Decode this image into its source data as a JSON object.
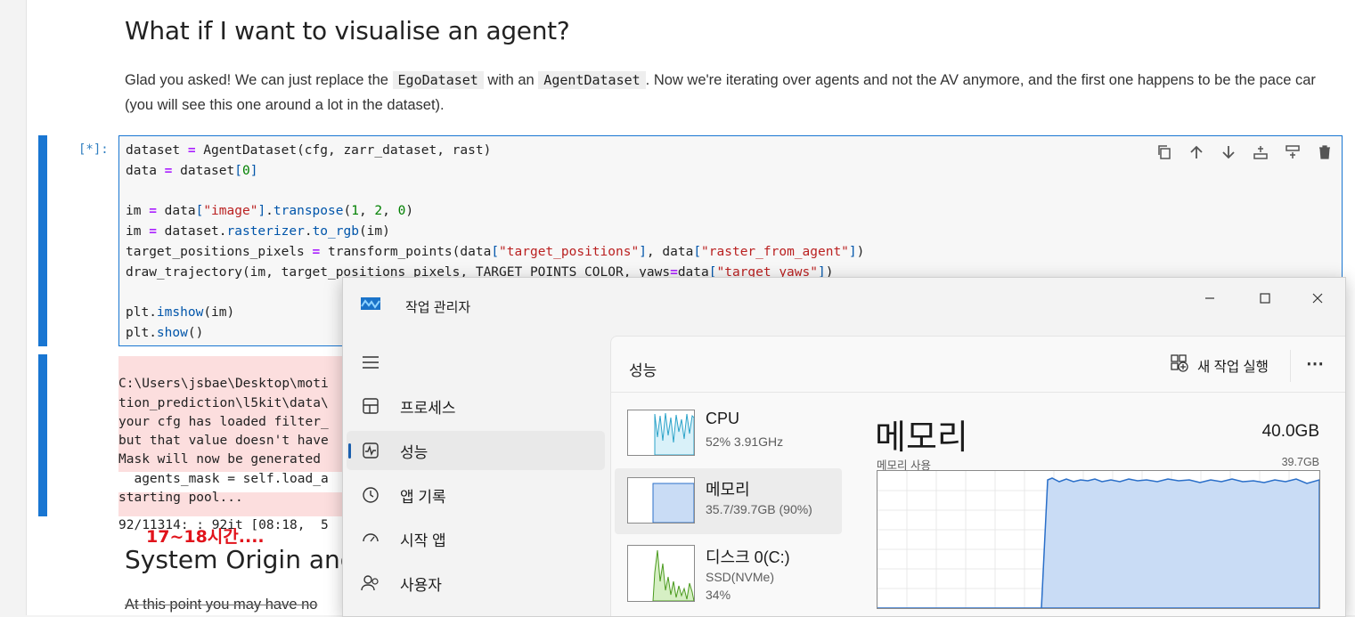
{
  "notebook": {
    "heading": "What if I want to visualise an agent?",
    "para_before1": "Glad you asked! We can just replace the ",
    "inline1": "EgoDataset",
    "para_mid": " with an ",
    "inline2": "AgentDataset",
    "para_after": ". Now we're iterating over agents and not the AV anymore, and the first one happens to be the pace car (you will see this one around a lot in the dataset).",
    "prompt": "[*]:",
    "output_lines": [
      "C:\\Users\\jsbae\\Desktop\\moti",
      "tion_prediction\\l5kit\\data\\",
      "your cfg has loaded filter_",
      "but that value doesn't have",
      "Mask will now be generated ",
      "  agents_mask = self.load_a",
      "starting pool...",
      "",
      "92/11314: : 92it [08:18,  5"
    ],
    "annotation": "17~18시간....",
    "heading2": "System Origin and",
    "para2": "At this point you may have no"
  },
  "task_manager": {
    "title": "작업 관리자",
    "nav": [
      "프로세스",
      "성능",
      "앱 기록",
      "시작 앱",
      "사용자"
    ],
    "active_nav": "성능",
    "panel_title": "성능",
    "new_task": "새 작업 실행",
    "resources": [
      {
        "name": "CPU",
        "sub": "52% 3.91GHz"
      },
      {
        "name": "메모리",
        "sub": "35.7/39.7GB (90%)"
      },
      {
        "name": "디스크 0(C:)",
        "sub1": "SSD(NVMe)",
        "sub2": "34%"
      }
    ],
    "memory": {
      "title": "메모리",
      "total": "40.0GB",
      "usage_label": "메모리 사용",
      "max_label": "39.7GB"
    }
  },
  "colors": {
    "accent": "#1976d2",
    "error_bg": "#fcdede",
    "annotation": "#e1131b",
    "mem_fill": "#c9dcf5",
    "mem_line": "#2a6fc9",
    "cpu_line": "#2ba3c9",
    "disk_line": "#4a9a1e"
  }
}
